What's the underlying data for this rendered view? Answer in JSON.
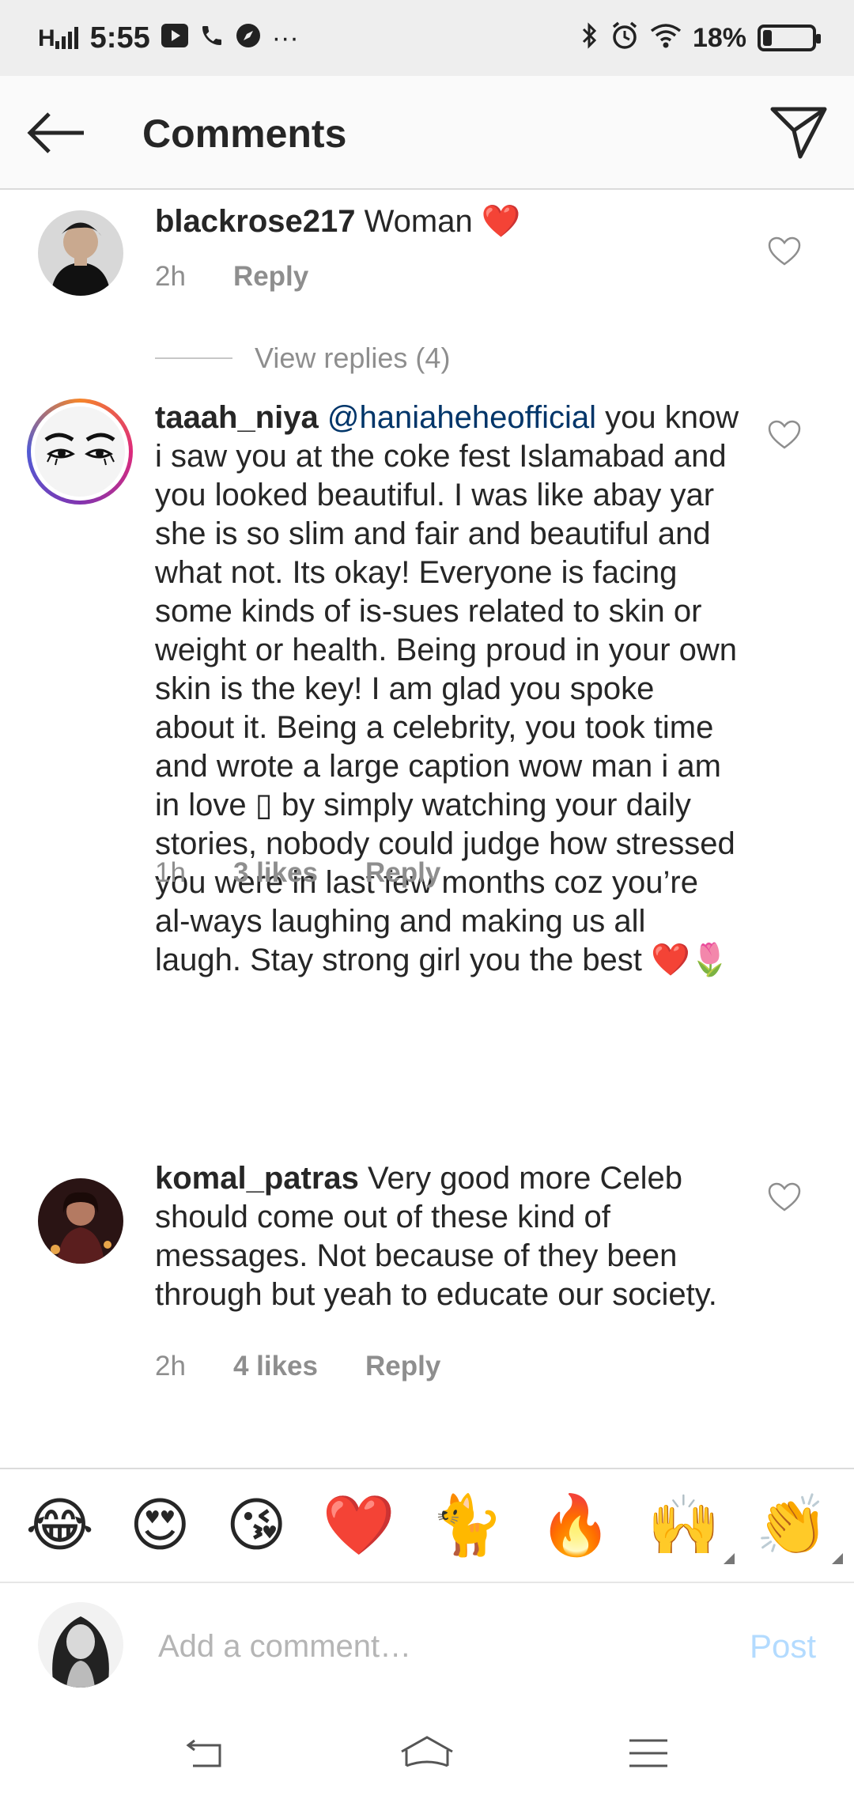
{
  "status_bar": {
    "signal": "H",
    "time": "5:55",
    "more": "···",
    "battery_pct": "18%",
    "battery_level": 0.18
  },
  "header": {
    "title": "Comments"
  },
  "comments": [
    {
      "username": "blackrose217",
      "text": " Woman ❤️",
      "time": "2h",
      "likes": "",
      "reply_label": "Reply",
      "view_replies": "View replies (4)"
    },
    {
      "username": "taaah_niya",
      "mention": "@haniaheheofficial",
      "text": " you know i saw you at the coke fest Islamabad and you looked beautiful. I was like abay yar she is so slim and fair and beautiful and what not. Its okay! Everyone is facing some kinds of is-sues related to skin or weight or health. Being proud in your own skin is the key! I am glad you spoke about it. Being a celebrity, you took time and wrote a large caption wow man i am in love ▯ by simply watching your daily stories, nobody could judge how stressed you were in last few months coz you’re al-ways laughing and making us all laugh. Stay strong girl you the best ❤️🌷",
      "time": "1h",
      "likes": "3 likes",
      "reply_label": "Reply"
    },
    {
      "username": "komal_patras",
      "text": " Very good more Celeb should come out of these kind of messages. Not because of they been through but yeah to educate our society.",
      "time": "2h",
      "likes": "4 likes",
      "reply_label": "Reply"
    }
  ],
  "emoji_bar": [
    "😂",
    "😍",
    "😘",
    "❤️",
    "🐈",
    "🔥",
    "🙌",
    "👏"
  ],
  "input": {
    "placeholder": "Add a comment…",
    "post_label": "Post"
  }
}
